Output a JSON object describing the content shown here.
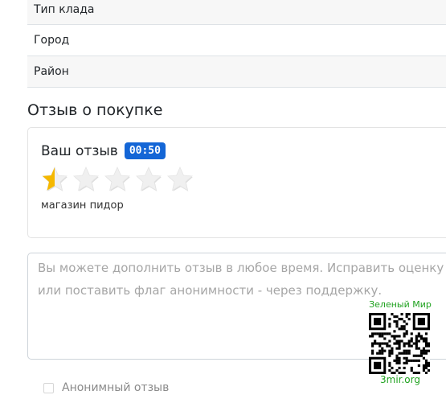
{
  "info_rows": [
    {
      "label": "Тип клада"
    },
    {
      "label": "Город"
    },
    {
      "label": "Район"
    }
  ],
  "section_title": "Отзыв о покупке",
  "review": {
    "label": "Ваш отзыв",
    "timer": "00:50",
    "rating": 0.5,
    "rating_max": 5,
    "text": "магазин пидор"
  },
  "comment": {
    "placeholder": "Вы можете дополнить отзыв в любое время. Исправить оценку или поставить флаг анонимности - через поддержку."
  },
  "watermark": {
    "title": "Зеленый Мир",
    "url": "3mir.org"
  },
  "anonymous": {
    "label": "Анонимный отзыв",
    "checked": false
  },
  "colors": {
    "accent": "#1466d6",
    "star_filled": "#f5b800",
    "star_empty": "#f0f0f0",
    "watermark": "#1fa21f"
  }
}
